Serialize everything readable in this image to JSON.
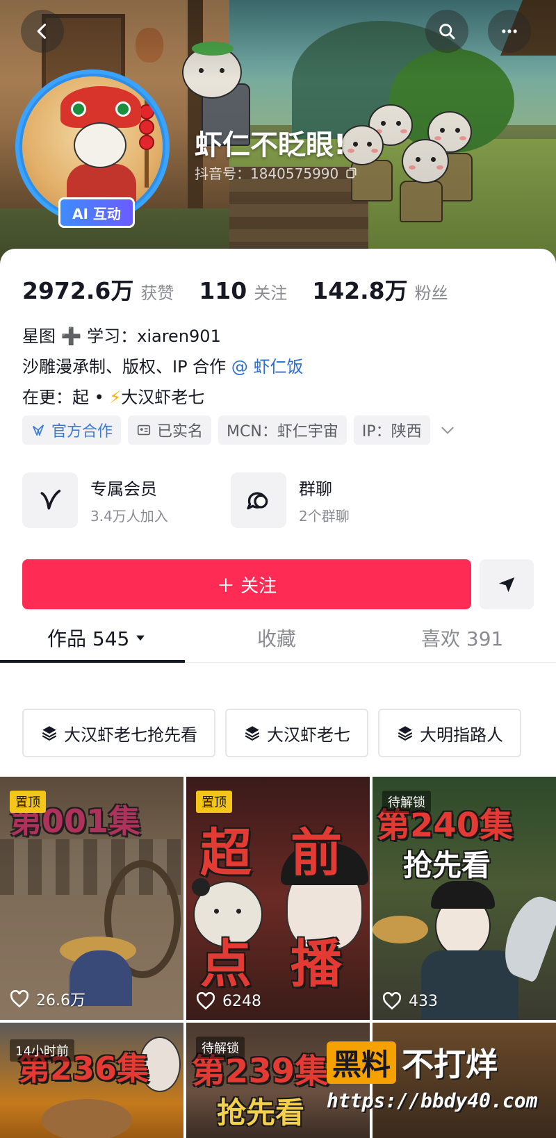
{
  "header": {
    "nickname": "虾仁不眨眼!",
    "douyin_id": "抖音号：1840575990",
    "ai_badge": "AI 互动"
  },
  "stats": [
    {
      "value": "2972.6万",
      "label": "获赞"
    },
    {
      "value": "110",
      "label": "关注"
    },
    {
      "value": "142.8万",
      "label": "粉丝"
    }
  ],
  "bio": {
    "line1": "星图 ➕ 学习：xiaren901",
    "line2_prefix": "沙雕漫承制、版权、IP 合作 ",
    "line2_mention": "@ 虾仁饭",
    "line3_prefix": "在更：起 • ",
    "line3_bolt": "⚡",
    "line3_suffix": "大汉虾老七"
  },
  "tags": [
    {
      "label": "官方合作",
      "icon": "official-icon"
    },
    {
      "label": "已实名",
      "icon": "id-card-icon"
    },
    {
      "label": "MCN：虾仁宇宙"
    },
    {
      "label": "IP：陕西"
    }
  ],
  "services": [
    {
      "title": "专属会员",
      "subtitle": "3.4万人加入",
      "icon": "membership-v-icon"
    },
    {
      "title": "群聊",
      "subtitle": "2个群聊",
      "icon": "group-chat-icon"
    }
  ],
  "follow_label": "＋ 关注",
  "tabs": [
    {
      "label": "作品 545",
      "active": true
    },
    {
      "label": "收藏",
      "active": false
    },
    {
      "label": "喜欢 391",
      "active": false
    }
  ],
  "collections": [
    "大汉虾老七抢先看",
    "大汉虾老七",
    "大明指路人"
  ],
  "videos": [
    {
      "badge": "置顶",
      "likes": "26.6万",
      "title": "第001集"
    },
    {
      "badge": "置顶",
      "likes": "6248",
      "title_chars": [
        "超",
        "前",
        "点",
        "播"
      ]
    },
    {
      "badge": "待解锁",
      "likes": "433",
      "title": "第240集",
      "subtitle": "抢先看"
    },
    {
      "badge": "14小时前",
      "title": "第236集"
    },
    {
      "badge": "待解锁",
      "title": "第239集",
      "subtitle": "抢先看"
    },
    {}
  ],
  "watermark": {
    "hei": "黑料",
    "bu": "不打烊",
    "url": "https://bbdy40.com"
  },
  "colors": {
    "follow": "#fe2c55",
    "pin_badge": "#f5c518",
    "mention": "#2d6fcf"
  }
}
